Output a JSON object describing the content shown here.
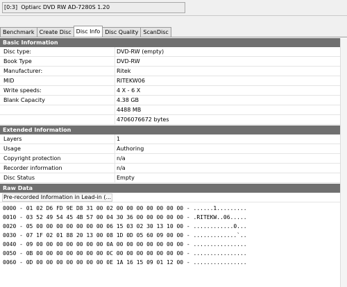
{
  "drive": {
    "selected": "[0:3]  Optiarc DVD RW AD-7280S 1.20"
  },
  "tabs": [
    {
      "label": "Benchmark",
      "active": false
    },
    {
      "label": "Create Disc",
      "active": false
    },
    {
      "label": "Disc Info",
      "active": true
    },
    {
      "label": "Disc Quality",
      "active": false
    },
    {
      "label": "ScanDisc",
      "active": false
    }
  ],
  "basic": {
    "title": "Basic Information",
    "rows": [
      {
        "label": "Disc type:",
        "value": "DVD-RW (empty)"
      },
      {
        "label": "Book Type",
        "value": "DVD-RW"
      },
      {
        "label": "Manufacturer:",
        "value": "Ritek"
      },
      {
        "label": "MID",
        "value": "RITEKW06"
      },
      {
        "label": "Write speeds:",
        "value": "4 X - 6 X"
      },
      {
        "label": "Blank Capacity",
        "value": "4.38 GB"
      },
      {
        "label": "",
        "value": "4488 MB"
      },
      {
        "label": "",
        "value": "4706076672 bytes"
      }
    ]
  },
  "extended": {
    "title": "Extended Information",
    "rows": [
      {
        "label": "Layers",
        "value": "1"
      },
      {
        "label": "Usage",
        "value": "Authoring"
      },
      {
        "label": "Copyright protection",
        "value": "n/a"
      },
      {
        "label": "Recorder information",
        "value": "n/a"
      },
      {
        "label": "Disc Status",
        "value": "Empty"
      }
    ]
  },
  "raw": {
    "title": "Raw Data",
    "dropdown": "Pre-recorded Information in Lead-in (...",
    "lines": [
      "0000 - 01 02 D6 FD 9E D8 31 00 02 00 00 00 00 00 00 00 - ......1.........",
      "0010 - 03 52 49 54 45 4B 57 00 04 30 36 00 00 00 00 00 - .RITEKW..06.....",
      "0020 - 05 00 00 00 00 00 00 00 06 15 03 02 30 13 10 00 - ............0...",
      "0030 - 07 1F 02 01 88 20 13 00 08 1D 0D 05 60 09 00 00 - .............`..",
      "0040 - 09 00 00 00 00 00 00 00 0A 00 00 00 00 00 00 00 - ................",
      "0050 - 0B 00 00 00 00 00 00 00 0C 00 00 00 00 00 00 00 - ................",
      "0060 - 0D 00 00 00 00 00 00 00 0E 1A 16 15 09 01 12 00 - ................"
    ]
  }
}
